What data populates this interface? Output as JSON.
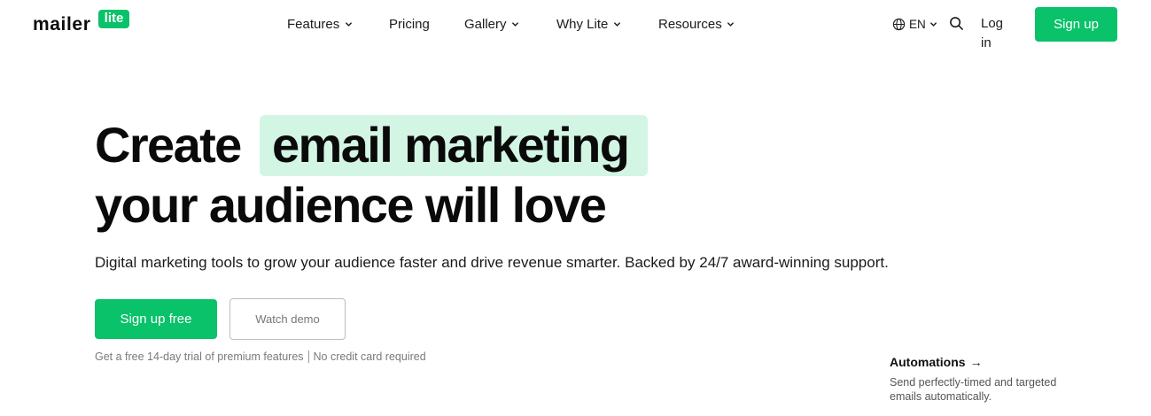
{
  "brand": {
    "wordmark": "mailer",
    "tag": "lite",
    "accent_color": "#09c269",
    "highlight_color": "#d2f5e4"
  },
  "nav": {
    "items": [
      {
        "label": "Features",
        "has_dropdown": true
      },
      {
        "label": "Pricing",
        "has_dropdown": false
      },
      {
        "label": "Gallery",
        "has_dropdown": true
      },
      {
        "label": "Why Lite",
        "has_dropdown": true
      },
      {
        "label": "Resources",
        "has_dropdown": true
      }
    ],
    "language": "EN",
    "login_label": "Log in",
    "signup_label": "Sign up"
  },
  "hero": {
    "title_word1": "Create",
    "title_highlight": "email marketing",
    "title_line2": "your audience will love",
    "subtitle": "Digital marketing tools to grow your audience faster and drive revenue smarter. Backed by 24/7 award-winning support.",
    "primary_cta": "Sign up free",
    "secondary_cta": "Watch demo",
    "fine_print_left": "Get a free 14-day trial of premium features",
    "fine_print_right": "No credit card required"
  },
  "feature_card": {
    "title": "Automations",
    "arrow": "→",
    "description": "Send perfectly-timed and targeted emails automatically."
  }
}
